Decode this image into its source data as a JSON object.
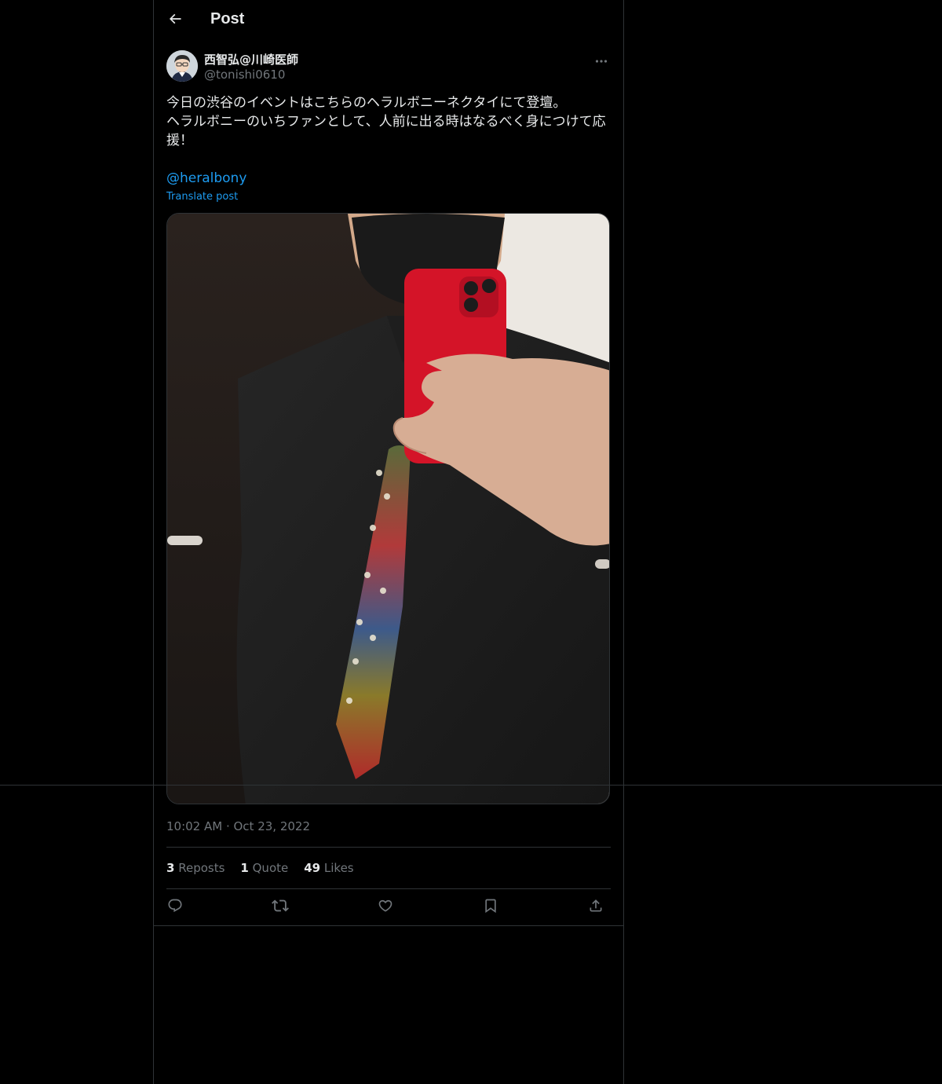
{
  "header": {
    "title": "Post",
    "back_icon": "arrow-left-icon"
  },
  "tweet": {
    "author": {
      "display_name": "西智弘@川崎医師",
      "handle": "@tonishi0610",
      "avatar_icon": "avatar-illustration"
    },
    "text_lines": [
      "今日の渋谷のイベントはこちらのヘラルボニーネクタイにて登壇。",
      "ヘラルボニーのいちファンとして、人前に出る時はなるべく身につけて応",
      "援！"
    ],
    "mention": "@heralbony",
    "translate_label": "Translate post",
    "timestamp": "10:02 AM · Oct 23, 2022",
    "stats": {
      "reposts_count": "3",
      "reposts_label": "Reposts",
      "quotes_count": "1",
      "quotes_label": "Quote",
      "likes_count": "49",
      "likes_label": "Likes"
    },
    "actions": [
      "reply-icon",
      "repost-icon",
      "like-icon",
      "bookmark-icon",
      "share-icon"
    ]
  },
  "colors": {
    "background": "#000000",
    "text": "#e7e9ea",
    "secondary_text": "#71767b",
    "link": "#1d9bf0",
    "border": "#2f3336"
  }
}
